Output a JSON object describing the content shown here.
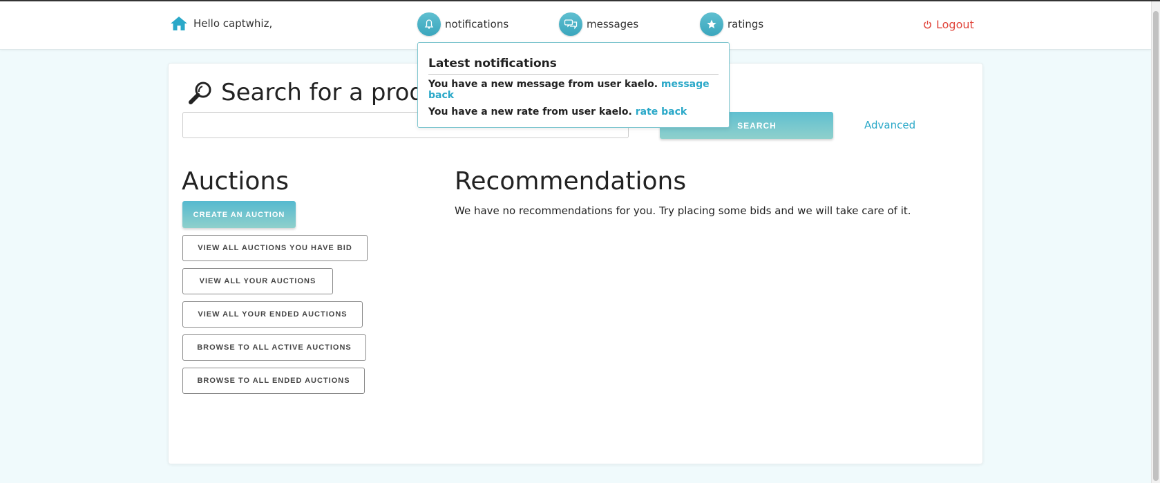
{
  "nav": {
    "greeting": "Hello captwhiz,",
    "notifications": "notifications",
    "messages": "messages",
    "ratings": "ratings",
    "logout": "Logout"
  },
  "search": {
    "title": "Search for a produ",
    "button": "SEARCH",
    "advanced": "Advanced"
  },
  "auctions": {
    "title": "Auctions",
    "create": "CREATE AN AUCTION",
    "buttons": [
      "VIEW ALL AUCTIONS YOU HAVE BID",
      "VIEW ALL YOUR AUCTIONS",
      "VIEW ALL YOUR ENDED AUCTIONS",
      "BROWSE TO ALL ACTIVE AUCTIONS",
      "BROWSE TO ALL ENDED AUCTIONS"
    ]
  },
  "recommendations": {
    "title": "Recommendations",
    "text": "We have no recommendations for you. Try placing some bids and we will take care of it."
  },
  "notifications_popup": {
    "title": "Latest notifications",
    "items": [
      {
        "text": "You have a new message from user kaelo.",
        "link": "message back"
      },
      {
        "text": "You have a new rate from user kaelo.",
        "link": "rate back"
      }
    ]
  },
  "colors": {
    "accent": "#2aa8c8",
    "logout": "#e0443a",
    "background": "#f0fafc"
  }
}
